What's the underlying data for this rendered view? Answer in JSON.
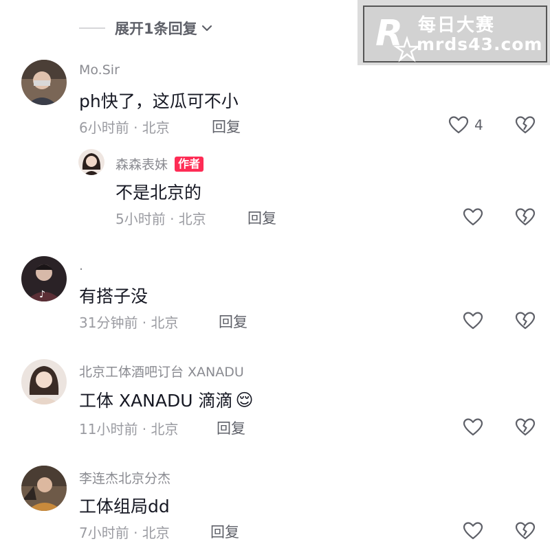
{
  "expand_replies": {
    "label": "展开1条回复"
  },
  "watermark": {
    "name": "每日大赛",
    "site": "mrds43.com",
    "logo_letter": "R"
  },
  "comments": [
    {
      "username": "Mo.Sir",
      "text": "ph快了，这瓜可不小",
      "meta": "6小时前 · 北京",
      "reply_label": "回复",
      "like_count": "4",
      "avatar_color": "#6b5a4e"
    },
    {
      "username": "森森表妹",
      "badge": "作者",
      "text": "不是北京的",
      "meta": "5小时前 · 北京",
      "reply_label": "回复",
      "avatar_color": "#c9b7ad"
    },
    {
      "username": ".",
      "text": "有搭子没",
      "meta": "31分钟前 · 北京",
      "reply_label": "回复",
      "avatar_color": "#3b2a2f"
    },
    {
      "username": "北京工体酒吧订台 XANADU",
      "text": "工体 XANADU 滴滴",
      "emoji": "😌",
      "meta": "11小时前 · 北京",
      "reply_label": "回复",
      "avatar_color": "#d9c4b6"
    },
    {
      "username": "李连杰北京分杰",
      "text": "工体组局dd",
      "meta": "7小时前 · 北京",
      "reply_label": "回复",
      "avatar_color": "#5a4636"
    }
  ]
}
